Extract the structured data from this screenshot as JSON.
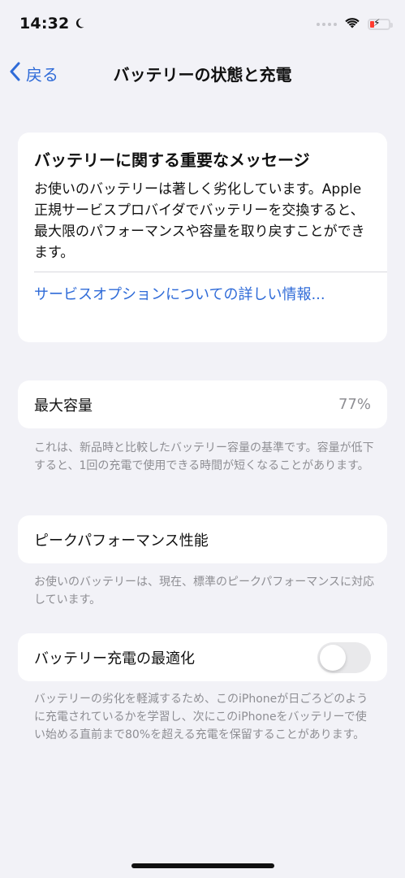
{
  "status_bar": {
    "time": "14:32"
  },
  "nav": {
    "back_label": "戻る",
    "title": "バッテリーの状態と充電"
  },
  "message_card": {
    "title": "バッテリーに関する重要なメッセージ",
    "body": "お使いのバッテリーは著しく劣化しています。Apple 正規サービスプロバイダでバッテリーを交換すると、最大限のパフォーマンスや容量を取り戻すことができます。",
    "link": "サービスオプションについての詳しい情報..."
  },
  "capacity": {
    "label": "最大容量",
    "value": "77%",
    "footnote": "これは、新品時と比較したバッテリー容量の基準です。容量が低下すると、1回の充電で使用できる時間が短くなることがあります。"
  },
  "peak_performance": {
    "label": "ピークパフォーマンス性能",
    "footnote": "お使いのバッテリーは、現在、標準のピークパフォーマンスに対応しています。"
  },
  "optimized_charging": {
    "label": "バッテリー充電の最適化",
    "enabled": false,
    "footnote": "バッテリーの劣化を軽減するため、このiPhoneが日ごろどのように充電されているかを学習し、次にこのiPhoneをバッテリーで使い始める直前まで80%を超える充電を保留することがあります。"
  },
  "colors": {
    "accent": "#2f6bd8",
    "background": "#f2f2f7",
    "card": "#ffffff",
    "secondary_text": "#8e8e93",
    "battery_low": "#ff3b30"
  },
  "icons": {
    "moon": "moon-icon",
    "wifi": "wifi-icon",
    "battery": "battery-charging-icon",
    "back": "chevron-left-icon"
  }
}
